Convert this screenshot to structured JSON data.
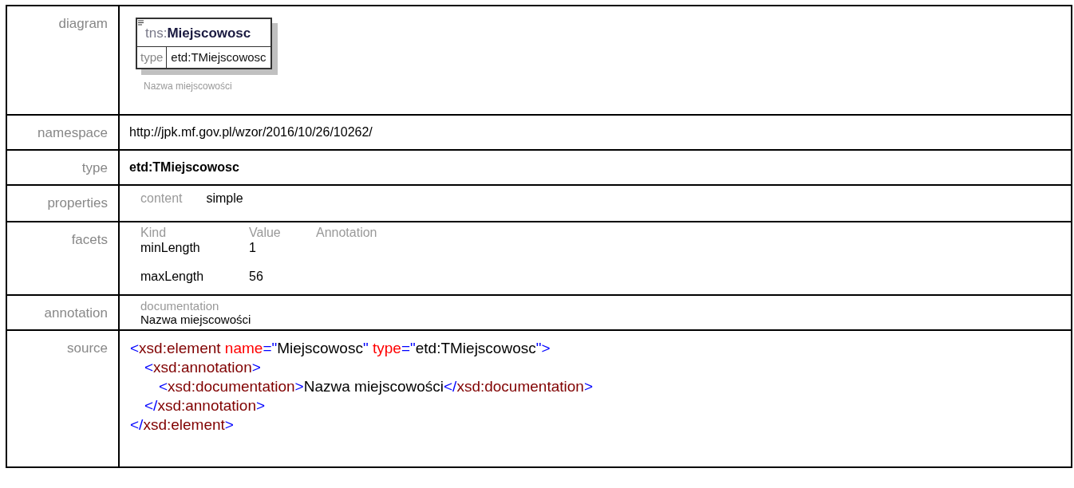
{
  "rows": [
    {
      "kind": "diagram",
      "label": "diagram",
      "element": {
        "prefix": "tns:",
        "name": "Miejscowosc",
        "type_label": "type",
        "type": "etd:TMiejscowosc",
        "annotation": "Nazwa miejscowości"
      }
    },
    {
      "kind": "text",
      "label": "namespace",
      "value": "http://jpk.mf.gov.pl/wzor/2016/10/26/10262/"
    },
    {
      "kind": "bold",
      "label": "type",
      "value": "etd:TMiejscowosc"
    },
    {
      "kind": "properties",
      "label": "properties",
      "items": [
        {
          "name": "content",
          "value": "simple"
        }
      ]
    },
    {
      "kind": "facets",
      "label": "facets",
      "columns": [
        "Kind",
        "Value",
        "Annotation"
      ],
      "facets": [
        {
          "kind": "minLength",
          "value": "1"
        },
        {
          "kind": "maxLength",
          "value": "56"
        }
      ]
    },
    {
      "kind": "annotation",
      "label": "annotation",
      "heading": "documentation",
      "value": "Nazwa miejscowości"
    },
    {
      "kind": "source",
      "label": "source",
      "lines": [
        {
          "tokens": [
            {
              "kind": "bracket",
              "text": "<"
            },
            {
              "kind": "tag",
              "text": "xsd:element"
            },
            {
              "kind": "attr",
              "text": " name"
            },
            {
              "kind": "bracket",
              "text": "=\""
            },
            {
              "kind": "value",
              "text": "Miejscowosc"
            },
            {
              "kind": "bracket",
              "text": "\""
            },
            {
              "kind": "attr",
              "text": " type"
            },
            {
              "kind": "bracket",
              "text": "=\""
            },
            {
              "kind": "value",
              "text": "etd:TMiejscowosc"
            },
            {
              "kind": "bracket",
              "text": "\">"
            }
          ],
          "children": [
            {
              "tokens": [
                {
                  "kind": "bracket",
                  "text": "<"
                },
                {
                  "kind": "tag",
                  "text": "xsd:annotation"
                },
                {
                  "kind": "bracket",
                  "text": ">"
                }
              ],
              "children": [
                {
                  "tokens": [
                    {
                      "kind": "bracket",
                      "text": "<"
                    },
                    {
                      "kind": "tag",
                      "text": "xsd:documentation"
                    },
                    {
                      "kind": "bracket",
                      "text": ">"
                    },
                    {
                      "kind": "value",
                      "text": "Nazwa miejscowości"
                    },
                    {
                      "kind": "bracket",
                      "text": "</"
                    },
                    {
                      "kind": "tag",
                      "text": "xsd:documentation"
                    },
                    {
                      "kind": "bracket",
                      "text": ">"
                    }
                  ]
                }
              ]
            },
            {
              "tokens": [
                {
                  "kind": "bracket",
                  "text": "</"
                },
                {
                  "kind": "tag",
                  "text": "xsd:annotation"
                },
                {
                  "kind": "bracket",
                  "text": ">"
                }
              ]
            }
          ]
        },
        {
          "tokens": [
            {
              "kind": "bracket",
              "text": "</"
            },
            {
              "kind": "tag",
              "text": "xsd:element"
            },
            {
              "kind": "bracket",
              "text": ">"
            }
          ]
        }
      ]
    }
  ]
}
